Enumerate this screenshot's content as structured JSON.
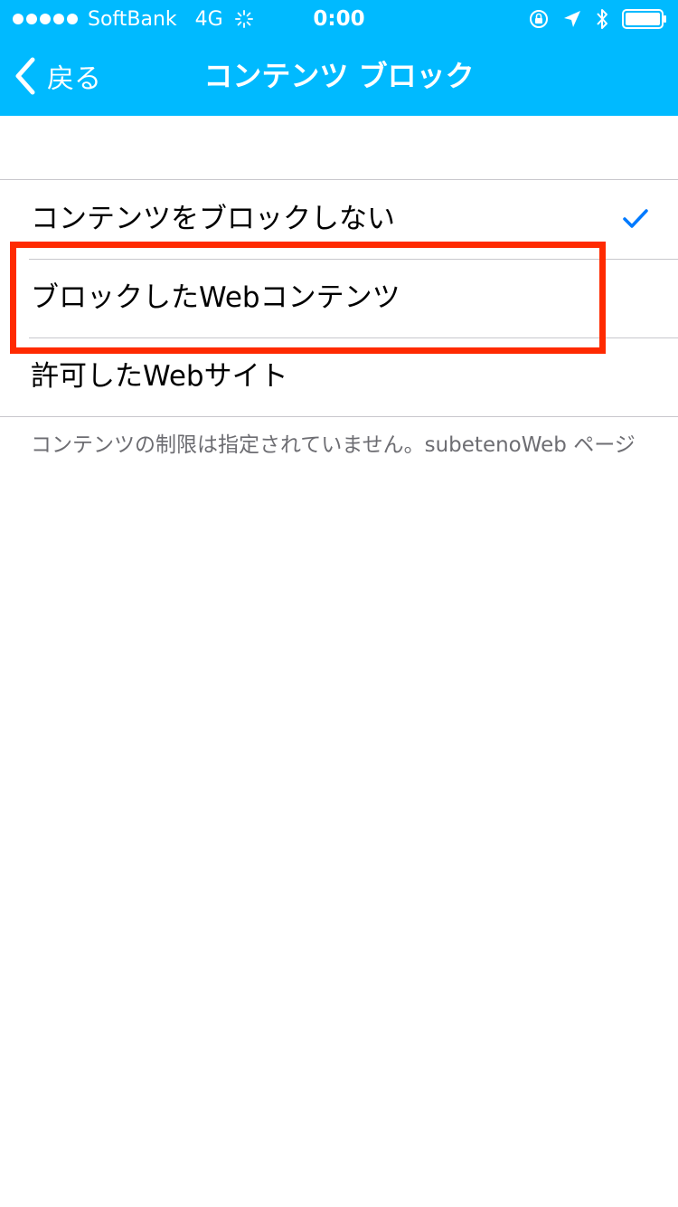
{
  "status_bar": {
    "carrier": "SoftBank",
    "network": "4G",
    "time": "0:00"
  },
  "nav": {
    "back_label": "戻る",
    "title": "コンテンツ ブロック"
  },
  "options": [
    {
      "label": "コンテンツをブロックしない",
      "selected": true
    },
    {
      "label": "ブロックしたWebコンテンツ",
      "selected": false
    },
    {
      "label": "許可したWebサイト",
      "selected": false
    }
  ],
  "footer_note": "コンテンツの制限は指定されていません。subetenoWeb ページ",
  "colors": {
    "header": "#00BAFF",
    "checkmark": "#007AFF",
    "highlight": "#FF2A00"
  },
  "icons": {
    "back": "chevron-left-icon",
    "check": "checkmark-icon",
    "location": "location-arrow-icon",
    "bluetooth": "bluetooth-icon",
    "battery": "battery-icon",
    "rotation_lock": "rotation-lock-icon"
  }
}
